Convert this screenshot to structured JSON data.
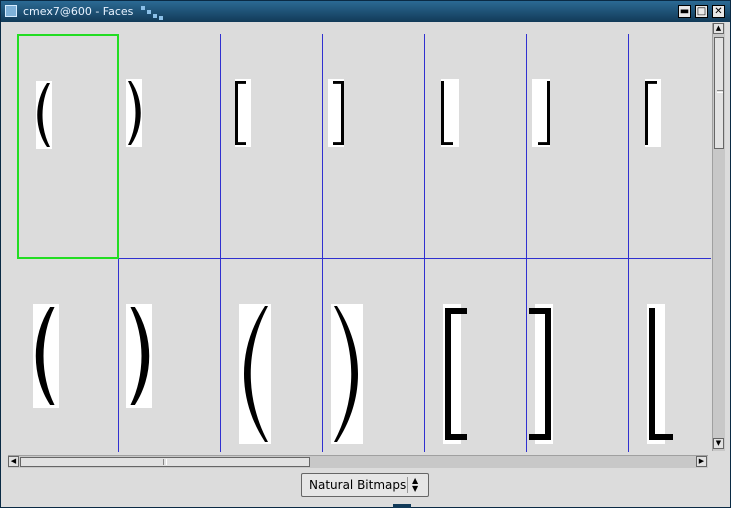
{
  "window": {
    "title": "cmex7@600 - Faces"
  },
  "titlebar_buttons": [
    {
      "name": "minimize-button",
      "glyph": "▬"
    },
    {
      "name": "maximize-button",
      "glyph": "□"
    },
    {
      "name": "close-button",
      "glyph": "✕"
    }
  ],
  "faces": {
    "selected_index": 0,
    "rows": [
      [
        {
          "glyph": "paren-left"
        },
        {
          "glyph": "paren-right"
        },
        {
          "glyph": "bracket-left"
        },
        {
          "glyph": "bracket-right"
        },
        {
          "glyph": "floor-left"
        },
        {
          "glyph": "floor-right"
        },
        {
          "glyph": "ceil-left"
        }
      ],
      [
        {
          "glyph": "paren-left"
        },
        {
          "glyph": "paren-right"
        },
        {
          "glyph": "paren-left-large"
        },
        {
          "glyph": "paren-right-large"
        },
        {
          "glyph": "bracket-left"
        },
        {
          "glyph": "bracket-right"
        },
        {
          "glyph": "floor-left"
        }
      ]
    ]
  },
  "scrollbars": {
    "vertical": {
      "up_glyph": "▲",
      "down_glyph": "▼"
    },
    "horizontal": {
      "left_glyph": "◀",
      "right_glyph": "▶"
    }
  },
  "bitmap_select": {
    "value": "Natural Bitmaps",
    "up_glyph": "▲",
    "down_glyph": "▼"
  },
  "colors": {
    "grid": "#3030d0",
    "selection": "#22dd22",
    "titlebar": "#123a58"
  }
}
